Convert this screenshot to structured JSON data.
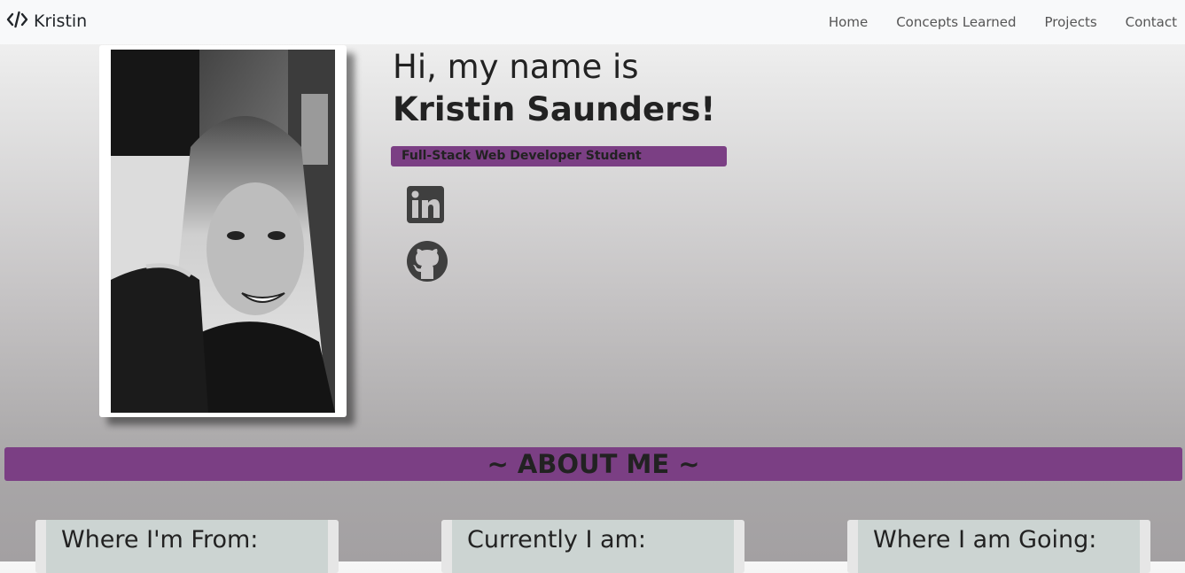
{
  "navbar": {
    "brand": "Kristin",
    "links": [
      "Home",
      "Concepts Learned",
      "Projects",
      "Contact"
    ]
  },
  "hero": {
    "greeting": "Hi, my name is",
    "name": "Kristin Saunders!",
    "subtitle": "Full-Stack Web Developer Student",
    "photo_alt": "Black and white portrait photo of Kristin"
  },
  "social": {
    "icons": [
      "linkedin-icon",
      "github-icon"
    ]
  },
  "about": {
    "heading": "~ ABOUT ME ~",
    "cards": [
      "Where I'm From:",
      "Currently I am:",
      "Where I am Going:"
    ]
  },
  "colors": {
    "accent": "#7b3f84",
    "navbar_bg": "#f8f9fa",
    "card_bg": "#ccd4d2"
  }
}
